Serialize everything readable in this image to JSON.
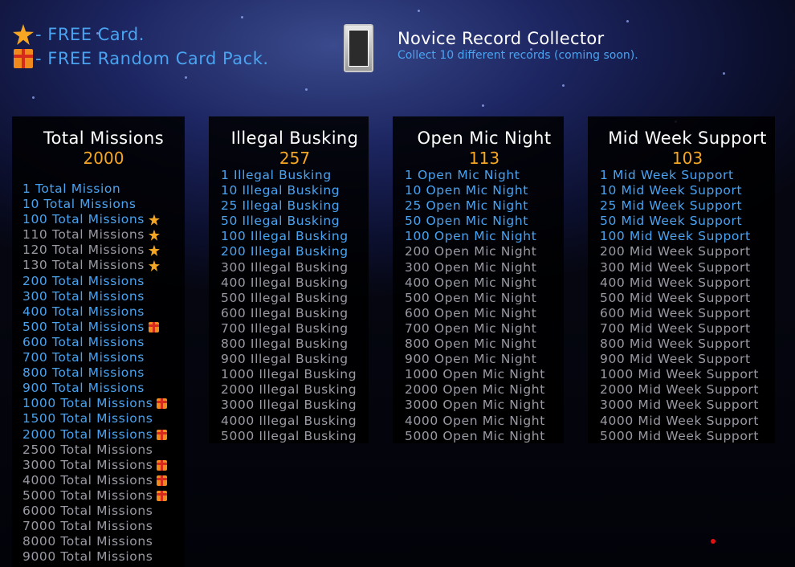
{
  "legend": [
    {
      "icon": "star-icon",
      "text": "- FREE Card."
    },
    {
      "icon": "gift-icon",
      "text": "- FREE Random Card Pack."
    }
  ],
  "achievement": {
    "title": "Novice Record Collector",
    "description": "Collect 10 different records (coming soon)."
  },
  "columns": [
    {
      "title": "Total Missions",
      "count": "2000",
      "items": [
        {
          "label": "1 Total Mission",
          "done": true,
          "reward": ""
        },
        {
          "label": "10 Total Missions",
          "done": true,
          "reward": ""
        },
        {
          "label": "100 Total Missions",
          "done": true,
          "reward": "star"
        },
        {
          "label": "110 Total Missions",
          "done": false,
          "reward": "star"
        },
        {
          "label": "120 Total Missions",
          "done": false,
          "reward": "star"
        },
        {
          "label": "130 Total Missions",
          "done": false,
          "reward": "star"
        },
        {
          "label": "200 Total Missions",
          "done": true,
          "reward": ""
        },
        {
          "label": "300 Total Missions",
          "done": true,
          "reward": ""
        },
        {
          "label": "400 Total Missions",
          "done": true,
          "reward": ""
        },
        {
          "label": "500 Total Missions",
          "done": true,
          "reward": "gift"
        },
        {
          "label": "600 Total Missions",
          "done": true,
          "reward": ""
        },
        {
          "label": "700 Total Missions",
          "done": true,
          "reward": ""
        },
        {
          "label": "800 Total Missions",
          "done": true,
          "reward": ""
        },
        {
          "label": "900 Total Missions",
          "done": true,
          "reward": ""
        },
        {
          "label": "1000 Total Missions",
          "done": true,
          "reward": "gift"
        },
        {
          "label": "1500 Total Missions",
          "done": true,
          "reward": ""
        },
        {
          "label": "2000 Total Missions",
          "done": true,
          "reward": "gift"
        },
        {
          "label": "2500 Total Missions",
          "done": false,
          "reward": ""
        },
        {
          "label": "3000 Total Missions",
          "done": false,
          "reward": "gift"
        },
        {
          "label": "4000 Total Missions",
          "done": false,
          "reward": "gift"
        },
        {
          "label": "5000 Total Missions",
          "done": false,
          "reward": "gift"
        },
        {
          "label": "6000 Total Missions",
          "done": false,
          "reward": ""
        },
        {
          "label": "7000 Total Missions",
          "done": false,
          "reward": ""
        },
        {
          "label": "8000 Total Missions",
          "done": false,
          "reward": ""
        },
        {
          "label": "9000 Total Missions",
          "done": false,
          "reward": ""
        }
      ]
    },
    {
      "title": "Illegal Busking",
      "count": "257",
      "items": [
        {
          "label": "1 Illegal Busking",
          "done": true,
          "reward": ""
        },
        {
          "label": "10 Illegal Busking",
          "done": true,
          "reward": ""
        },
        {
          "label": "25 Illegal Busking",
          "done": true,
          "reward": ""
        },
        {
          "label": "50 Illegal Busking",
          "done": true,
          "reward": ""
        },
        {
          "label": "100 Illegal Busking",
          "done": true,
          "reward": ""
        },
        {
          "label": "200 Illegal Busking",
          "done": true,
          "reward": ""
        },
        {
          "label": "300 Illegal Busking",
          "done": false,
          "reward": ""
        },
        {
          "label": "400 Illegal Busking",
          "done": false,
          "reward": ""
        },
        {
          "label": "500 Illegal Busking",
          "done": false,
          "reward": ""
        },
        {
          "label": "600 Illegal Busking",
          "done": false,
          "reward": ""
        },
        {
          "label": "700 Illegal Busking",
          "done": false,
          "reward": ""
        },
        {
          "label": "800 Illegal Busking",
          "done": false,
          "reward": ""
        },
        {
          "label": "900 Illegal Busking",
          "done": false,
          "reward": ""
        },
        {
          "label": "1000 Illegal Busking",
          "done": false,
          "reward": ""
        },
        {
          "label": "2000 Illegal Busking",
          "done": false,
          "reward": ""
        },
        {
          "label": "3000 Illegal Busking",
          "done": false,
          "reward": ""
        },
        {
          "label": "4000 Illegal Busking",
          "done": false,
          "reward": ""
        },
        {
          "label": "5000 Illegal Busking",
          "done": false,
          "reward": ""
        }
      ]
    },
    {
      "title": "Open Mic Night",
      "count": "113",
      "items": [
        {
          "label": "1 Open Mic Night",
          "done": true,
          "reward": ""
        },
        {
          "label": "10 Open Mic Night",
          "done": true,
          "reward": ""
        },
        {
          "label": "25 Open Mic Night",
          "done": true,
          "reward": ""
        },
        {
          "label": "50 Open Mic Night",
          "done": true,
          "reward": ""
        },
        {
          "label": "100 Open Mic Night",
          "done": true,
          "reward": ""
        },
        {
          "label": "200 Open Mic Night",
          "done": false,
          "reward": ""
        },
        {
          "label": "300 Open Mic Night",
          "done": false,
          "reward": ""
        },
        {
          "label": "400 Open Mic Night",
          "done": false,
          "reward": ""
        },
        {
          "label": "500 Open Mic Night",
          "done": false,
          "reward": ""
        },
        {
          "label": "600 Open Mic Night",
          "done": false,
          "reward": ""
        },
        {
          "label": "700 Open Mic Night",
          "done": false,
          "reward": ""
        },
        {
          "label": "800 Open Mic Night",
          "done": false,
          "reward": ""
        },
        {
          "label": "900 Open Mic Night",
          "done": false,
          "reward": ""
        },
        {
          "label": "1000 Open Mic Night",
          "done": false,
          "reward": ""
        },
        {
          "label": "2000 Open Mic Night",
          "done": false,
          "reward": ""
        },
        {
          "label": "3000 Open Mic Night",
          "done": false,
          "reward": ""
        },
        {
          "label": "4000 Open Mic Night",
          "done": false,
          "reward": ""
        },
        {
          "label": "5000 Open Mic Night",
          "done": false,
          "reward": ""
        }
      ]
    },
    {
      "title": "Mid Week Support",
      "count": "103",
      "items": [
        {
          "label": "1 Mid Week Support",
          "done": true,
          "reward": ""
        },
        {
          "label": "10 Mid Week Support",
          "done": true,
          "reward": ""
        },
        {
          "label": "25 Mid Week Support",
          "done": true,
          "reward": ""
        },
        {
          "label": "50 Mid Week Support",
          "done": true,
          "reward": ""
        },
        {
          "label": "100 Mid Week Support",
          "done": true,
          "reward": ""
        },
        {
          "label": "200 Mid Week Support",
          "done": false,
          "reward": ""
        },
        {
          "label": "300 Mid Week Support",
          "done": false,
          "reward": ""
        },
        {
          "label": "400 Mid Week Support",
          "done": false,
          "reward": ""
        },
        {
          "label": "500 Mid Week Support",
          "done": false,
          "reward": ""
        },
        {
          "label": "600 Mid Week Support",
          "done": false,
          "reward": ""
        },
        {
          "label": "700 Mid Week Support",
          "done": false,
          "reward": ""
        },
        {
          "label": "800 Mid Week Support",
          "done": false,
          "reward": ""
        },
        {
          "label": "900 Mid Week Support",
          "done": false,
          "reward": ""
        },
        {
          "label": "1000 Mid Week Support",
          "done": false,
          "reward": ""
        },
        {
          "label": "2000 Mid Week Support",
          "done": false,
          "reward": ""
        },
        {
          "label": "3000 Mid Week Support",
          "done": false,
          "reward": ""
        },
        {
          "label": "4000 Mid Week Support",
          "done": false,
          "reward": ""
        },
        {
          "label": "5000 Mid Week Support",
          "done": false,
          "reward": ""
        }
      ]
    }
  ],
  "colors": {
    "done": "#4aa3f0",
    "todo": "#9a9aa4",
    "count": "#f5a623",
    "panel": "#000000"
  }
}
